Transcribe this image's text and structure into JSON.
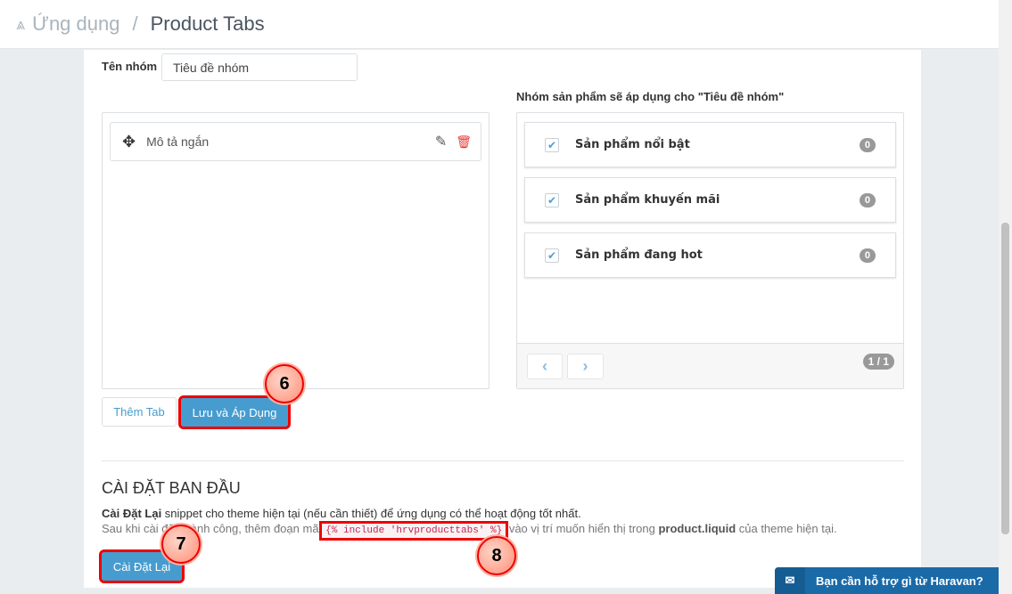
{
  "header": {
    "breadcrumb_root": "Ứng dụng",
    "separator": "/",
    "breadcrumb_current": "Product Tabs"
  },
  "form": {
    "group_name_label": "Tên nhóm",
    "group_name_value": "Tiêu đề nhóm"
  },
  "tabs": {
    "items": [
      {
        "label": "Mô tả ngắn"
      }
    ],
    "add_tab_label": "Thêm Tab",
    "save_apply_label": "Lưu và Áp Dụng"
  },
  "product_groups": {
    "title": "Nhóm sản phẩm sẽ áp dụng cho \"Tiêu đề nhóm\"",
    "items": [
      {
        "label": "Sản phẩm nổi bật",
        "count": "0",
        "checked": true
      },
      {
        "label": "Sản phẩm khuyến mãi",
        "count": "0",
        "checked": true
      },
      {
        "label": "Sản phẩm đang hot",
        "count": "0",
        "checked": true
      }
    ],
    "page_indicator": "1 / 1"
  },
  "setup": {
    "title": "CÀI ĐẶT BAN ĐẦU",
    "line1_bold": "Cài Đặt Lại",
    "line1_rest": " snippet cho theme hiện tại (nếu cần thiết) để ứng dụng có thể hoạt động tốt nhất.",
    "line2_pre": "Sau khi cài đặt thành công, thêm đoạn mã ",
    "code": "{% include 'hrvproducttabs' %}",
    "line2_mid": " vào vị trí muốn hiển thị trong ",
    "line2_bold": "product.liquid",
    "line2_post": " của theme hiện tại.",
    "reset_label": "Cài Đặt Lại"
  },
  "callouts": [
    "6",
    "7",
    "8"
  ],
  "support": {
    "label": "Bạn cần hỗ trợ gì từ Haravan?"
  },
  "colors": {
    "primary": "#479ccf",
    "annotation": "#ee0000",
    "delete": "#e53935"
  }
}
